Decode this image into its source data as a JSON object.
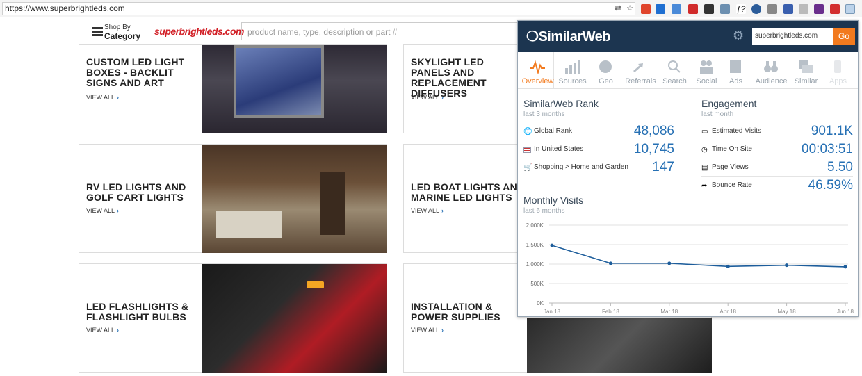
{
  "browser": {
    "url": "https://www.superbrightleds.com"
  },
  "site": {
    "shop_small": "Shop By",
    "shop_big": "Category",
    "logo": "superbrightleds.com",
    "search_placeholder": "product name, type, description or part #",
    "cards": [
      {
        "title": "CUSTOM LED LIGHT BOXES - BACKLIT SIGNS AND ART",
        "view_all": "VIEW ALL"
      },
      {
        "title": "SKYLIGHT LED PANELS AND REPLACEMENT DIFFUSERS",
        "view_all": "VIEW ALL"
      },
      {
        "title": "RV LED LIGHTS AND GOLF CART LIGHTS",
        "view_all": "VIEW ALL"
      },
      {
        "title": "LED BOAT LIGHTS AND MARINE LED LIGHTS",
        "view_all": "VIEW ALL"
      },
      {
        "title": "LED FLASHLIGHTS & FLASHLIGHT BULBS",
        "view_all": "VIEW ALL"
      },
      {
        "title": "INSTALLATION & POWER SUPPLIES",
        "view_all": "VIEW ALL"
      }
    ]
  },
  "similarweb": {
    "logo": "SimilarWeb",
    "input_value": "superbrightleds.com",
    "go_label": "Go",
    "nav": [
      "Overview",
      "Sources",
      "Geo",
      "Referrals",
      "Search",
      "Social",
      "Ads",
      "Audience",
      "Similar",
      "Apps"
    ],
    "rank": {
      "title": "SimilarWeb Rank",
      "subtitle": "last 3 months",
      "rows": [
        {
          "label": "Global Rank",
          "value": "48,086"
        },
        {
          "label": "In United States",
          "value": "10,745"
        },
        {
          "label": "Shopping > Home and Garden",
          "value": "147"
        }
      ]
    },
    "engagement": {
      "title": "Engagement",
      "subtitle": "last month",
      "rows": [
        {
          "label": "Estimated Visits",
          "value": "901.1K"
        },
        {
          "label": "Time On Site",
          "value": "00:03:51"
        },
        {
          "label": "Page Views",
          "value": "5.50"
        },
        {
          "label": "Bounce Rate",
          "value": "46.59%"
        }
      ]
    },
    "monthly": {
      "title": "Monthly Visits",
      "subtitle": "last 6 months"
    }
  },
  "colors": {
    "accent": "#f27a1e",
    "header": "#1c3550",
    "value": "#2670b4"
  },
  "chart_data": {
    "type": "line",
    "x": [
      "Jan 18",
      "Feb 18",
      "Mar 18",
      "Apr 18",
      "May 18",
      "Jun 18"
    ],
    "series": [
      {
        "values": [
          1480000,
          1020000,
          1020000,
          940000,
          970000,
          930000
        ]
      }
    ],
    "yticks": [
      "0K",
      "500K",
      "1,000K",
      "1,500K",
      "2,000K"
    ],
    "ylim": [
      0,
      2000000
    ],
    "grid": true
  }
}
